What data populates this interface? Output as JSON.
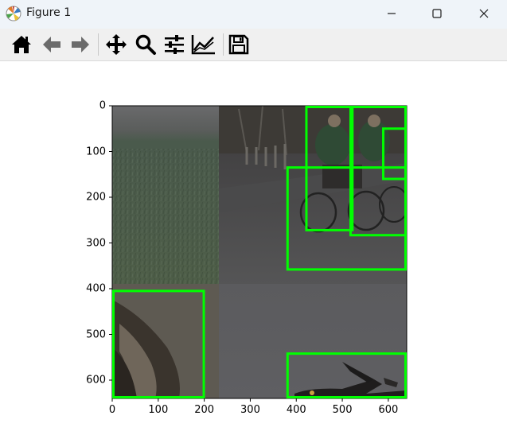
{
  "window": {
    "title": "Figure 1",
    "minimize_icon": "minimize-icon",
    "maximize_icon": "maximize-icon",
    "close_icon": "close-icon"
  },
  "toolbar": {
    "buttons": [
      {
        "name": "home",
        "icon": "home-icon"
      },
      {
        "name": "back",
        "icon": "arrow-left-icon"
      },
      {
        "name": "forward",
        "icon": "arrow-right-icon"
      },
      {
        "name": "pan",
        "icon": "move-icon"
      },
      {
        "name": "zoom",
        "icon": "magnifier-icon"
      },
      {
        "name": "subplots",
        "icon": "sliders-icon"
      },
      {
        "name": "customize",
        "icon": "line-chart-icon"
      },
      {
        "name": "save",
        "icon": "floppy-disk-icon"
      }
    ]
  },
  "plot": {
    "x_ticks": [
      "0",
      "100",
      "200",
      "300",
      "400",
      "500",
      "600"
    ],
    "y_ticks": [
      "0",
      "100",
      "200",
      "300",
      "400",
      "500",
      "600"
    ],
    "xlim": [
      0,
      640
    ],
    "ylim": [
      640,
      0
    ],
    "box_color": "#00ff00",
    "boxes": [
      {
        "x1": 422,
        "y1": 0,
        "x2": 522,
        "y2": 272
      },
      {
        "x1": 518,
        "y1": 0,
        "x2": 640,
        "y2": 283
      },
      {
        "x1": 589,
        "y1": 50,
        "x2": 640,
        "y2": 160
      },
      {
        "x1": 381,
        "y1": 135,
        "x2": 640,
        "y2": 358
      },
      {
        "x1": 0,
        "y1": 405,
        "x2": 199,
        "y2": 640
      },
      {
        "x1": 381,
        "y1": 542,
        "x2": 640,
        "y2": 640
      }
    ]
  }
}
